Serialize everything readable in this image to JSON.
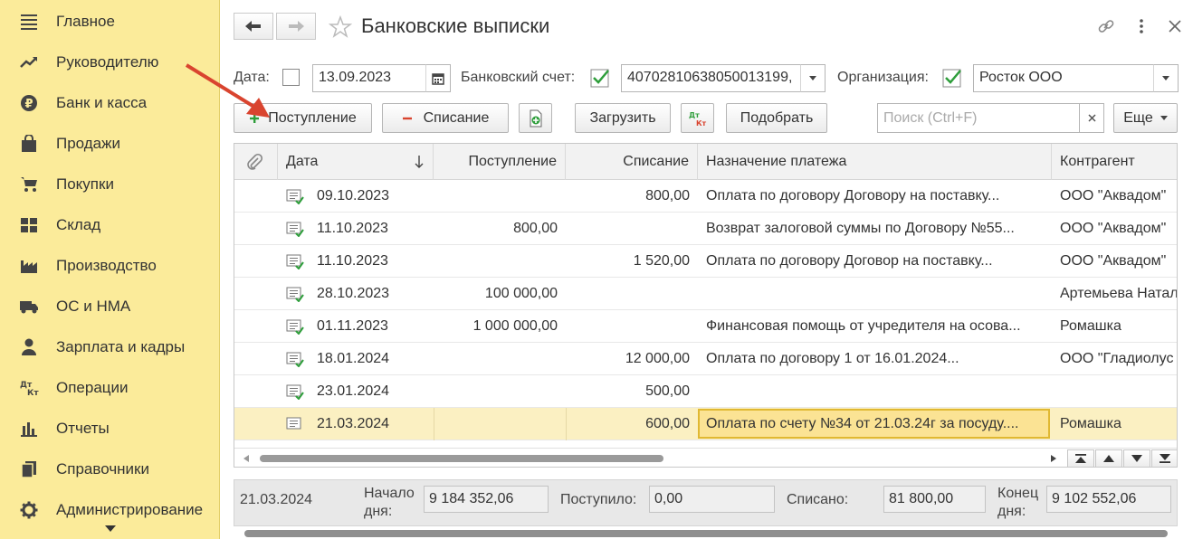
{
  "sidebar": {
    "items": [
      {
        "label": "Главное",
        "icon": "menu-lines-icon"
      },
      {
        "label": "Руководителю",
        "icon": "trend-icon"
      },
      {
        "label": "Банк и касса",
        "icon": "ruble-coin-icon"
      },
      {
        "label": "Продажи",
        "icon": "shopping-bag-icon"
      },
      {
        "label": "Покупки",
        "icon": "cart-icon"
      },
      {
        "label": "Склад",
        "icon": "warehouse-icon"
      },
      {
        "label": "Производство",
        "icon": "factory-icon"
      },
      {
        "label": "ОС и НМА",
        "icon": "truck-icon"
      },
      {
        "label": "Зарплата и кадры",
        "icon": "person-icon"
      },
      {
        "label": "Операции",
        "icon": "dt-kt-icon"
      },
      {
        "label": "Отчеты",
        "icon": "bar-chart-icon"
      },
      {
        "label": "Справочники",
        "icon": "books-icon"
      },
      {
        "label": "Администрирование",
        "icon": "gear-icon"
      }
    ]
  },
  "header": {
    "title": "Банковские выписки"
  },
  "filters": {
    "date_label": "Дата:",
    "date_value": "13.09.2023",
    "account_label": "Банковский счет:",
    "account_value": "40702810638050013199,",
    "org_label": "Организация:",
    "org_value": "Росток ООО"
  },
  "toolbar": {
    "income_label": "Поступление",
    "expense_label": "Списание",
    "load_label": "Загрузить",
    "dtkt_label": "Дт Кт",
    "select_label": "Подобрать",
    "search_placeholder": "Поиск (Ctrl+F)",
    "more_label": "Еще"
  },
  "table": {
    "columns": [
      "Дата",
      "Поступление",
      "Списание",
      "Назначение платежа",
      "Контрагент"
    ],
    "rows": [
      {
        "date": "09.10.2023",
        "income": "",
        "expense": "800,00",
        "purpose": "Оплата по договору Договору на поставку...",
        "counterparty": "ООО \"Аквадом\""
      },
      {
        "date": "11.10.2023",
        "income": "800,00",
        "expense": "",
        "purpose": "Возврат залоговой суммы  по Договору №55...",
        "counterparty": "ООО \"Аквадом\""
      },
      {
        "date": "11.10.2023",
        "income": "",
        "expense": "1 520,00",
        "purpose": "Оплата по договору Договор на поставку...",
        "counterparty": "ООО \"Аквадом\""
      },
      {
        "date": "28.10.2023",
        "income": "100 000,00",
        "expense": "",
        "purpose": "",
        "counterparty": "Артемьева Натал"
      },
      {
        "date": "01.11.2023",
        "income": "1 000 000,00",
        "expense": "",
        "purpose": "Финансовая помощь от учредителя на осова...",
        "counterparty": "Ромашка"
      },
      {
        "date": "18.01.2024",
        "income": "",
        "expense": "12 000,00",
        "purpose": "Оплата по договору 1 от 16.01.2024...",
        "counterparty": "ООО \"Гладиолус"
      },
      {
        "date": "23.01.2024",
        "income": "",
        "expense": "500,00",
        "purpose": "",
        "counterparty": ""
      },
      {
        "date": "21.03.2024",
        "income": "",
        "expense": "600,00",
        "purpose": "Оплата по счету №34 от 21.03.24г за посуду....",
        "counterparty": "Ромашка"
      }
    ]
  },
  "footer": {
    "date": "21.03.2024",
    "start_label": "Начало дня:",
    "start_value": "9 184 352,06",
    "received_label": "Поступило:",
    "received_value": "0,00",
    "spent_label": "Списано:",
    "spent_value": "81 800,00",
    "end_label": "Конец дня:",
    "end_value": "9 102 552,06"
  },
  "colors": {
    "sidebar_bg": "#fbeb9a",
    "selected_row": "#fbf0c2",
    "focus_cell": "#fbe394",
    "check_green": "#2e9e3b",
    "arrow_red": "#d9442f"
  }
}
